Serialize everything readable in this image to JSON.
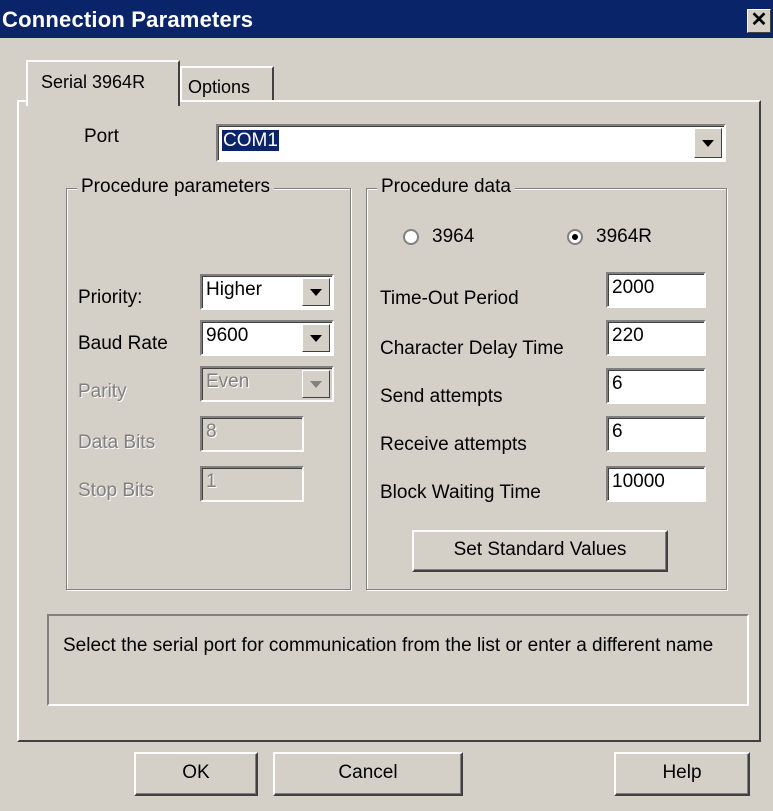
{
  "window": {
    "title": "Connection Parameters",
    "close_glyph": "✕"
  },
  "tabs": [
    {
      "label": "Serial 3964R",
      "active": true
    },
    {
      "label": "Options",
      "active": false
    }
  ],
  "port": {
    "label": "Port",
    "value": "COM1"
  },
  "procedure_parameters": {
    "title": "Procedure parameters",
    "priority": {
      "label": "Priority:",
      "value": "Higher"
    },
    "baud_rate": {
      "label": "Baud Rate",
      "value": "9600"
    },
    "parity": {
      "label": "Parity",
      "value": "Even",
      "disabled": true
    },
    "data_bits": {
      "label": "Data Bits",
      "value": "8",
      "disabled": true
    },
    "stop_bits": {
      "label": "Stop Bits",
      "value": "1",
      "disabled": true
    }
  },
  "procedure_data": {
    "title": "Procedure data",
    "radio_3964": {
      "label": "3964",
      "checked": false
    },
    "radio_3964r": {
      "label": "3964R",
      "checked": true
    },
    "timeout": {
      "label": "Time-Out Period",
      "value": "2000"
    },
    "char_delay": {
      "label": "Character Delay Time",
      "value": "220"
    },
    "send_attempts": {
      "label": "Send attempts",
      "value": "6"
    },
    "receive_attempts": {
      "label": "Receive attempts",
      "value": "6"
    },
    "block_wait": {
      "label": "Block Waiting Time",
      "value": "10000"
    },
    "set_standard": "Set Standard Values"
  },
  "info": "Select the serial port for communication from the list or enter a different name",
  "buttons": {
    "ok": "OK",
    "cancel": "Cancel",
    "help": "Help"
  },
  "icons": {
    "close": "close-icon",
    "dropdown": "chevron-down-icon"
  },
  "colors": {
    "titlebar": "#0a246a",
    "face": "#d4d0c8",
    "selection": "#0a246a"
  }
}
